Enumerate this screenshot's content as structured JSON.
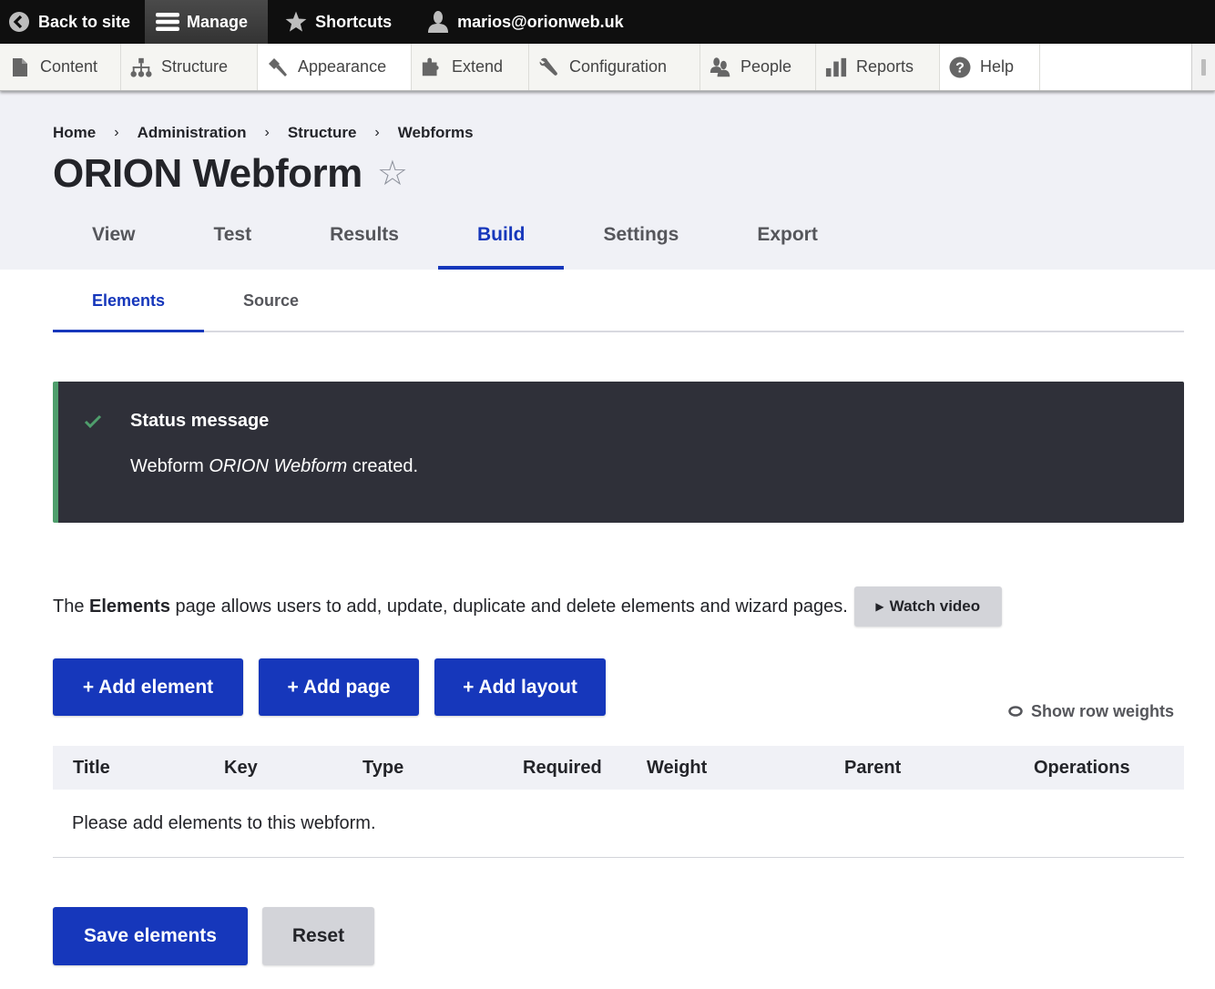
{
  "toolbar": {
    "back_to_site": "Back to site",
    "manage": "Manage",
    "shortcuts": "Shortcuts",
    "user": "marios@orionweb.uk"
  },
  "tray": {
    "items": [
      {
        "label": "Content",
        "icon": "file-icon"
      },
      {
        "label": "Structure",
        "icon": "sitemap-icon"
      },
      {
        "label": "Appearance",
        "icon": "paintbrush-icon"
      },
      {
        "label": "Extend",
        "icon": "puzzle-icon"
      },
      {
        "label": "Configuration",
        "icon": "wrench-icon"
      },
      {
        "label": "People",
        "icon": "people-icon"
      },
      {
        "label": "Reports",
        "icon": "bar-chart-icon"
      },
      {
        "label": "Help",
        "icon": "help-icon"
      }
    ]
  },
  "breadcrumb": [
    "Home",
    "Administration",
    "Structure",
    "Webforms"
  ],
  "breadcrumb_separator": "›",
  "page_title": "ORION Webform",
  "star_glyph": "☆",
  "primary_tabs": [
    {
      "label": "View",
      "active": false
    },
    {
      "label": "Test",
      "active": false
    },
    {
      "label": "Results",
      "active": false
    },
    {
      "label": "Build",
      "active": true
    },
    {
      "label": "Settings",
      "active": false
    },
    {
      "label": "Export",
      "active": false
    }
  ],
  "secondary_tabs": [
    {
      "label": "Elements",
      "active": true
    },
    {
      "label": "Source",
      "active": false
    }
  ],
  "status": {
    "title": "Status message",
    "body_prefix": "Webform ",
    "body_emphasis": "ORION Webform",
    "body_suffix": " created."
  },
  "description": {
    "prefix": "The ",
    "bold": "Elements",
    "suffix": " page allows users to add, update, duplicate and delete elements and wizard pages."
  },
  "watch_video": {
    "glyph": "▶",
    "label": "Watch video"
  },
  "actions": {
    "add_element": "+ Add element",
    "add_page": "+ Add page",
    "add_layout": "+ Add layout"
  },
  "show_row_weights": "Show row weights",
  "table": {
    "headers": [
      "Title",
      "Key",
      "Type",
      "Required",
      "Weight",
      "Parent",
      "Operations"
    ],
    "empty_message": "Please add elements to this webform."
  },
  "buttons": {
    "save": "Save elements",
    "reset": "Reset"
  },
  "colors": {
    "primary": "#1637bb",
    "status_accent": "#4f9e6c",
    "status_bg": "#2f3039",
    "header_bg": "#f0f1f6"
  }
}
